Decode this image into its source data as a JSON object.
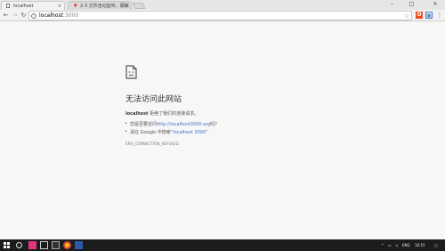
{
  "browser": {
    "tabs": [
      {
        "title": "localhost",
        "close": "×"
      },
      {
        "title": "2-3 文件自动监听，跟踪",
        "close": "×"
      }
    ],
    "window_controls": {
      "minimize": "–",
      "maximize": "□",
      "close": "×"
    },
    "nav": {
      "back": "←",
      "forward": "→",
      "reload": "↻"
    },
    "address": {
      "host": "localhost",
      "port": ":3000"
    },
    "star": "☆",
    "menu": "⋮"
  },
  "error_page": {
    "title": "无法访问此网站",
    "host": "localhost",
    "message": "拒绝了我们的连接请求。",
    "suggestions": [
      {
        "prefix": "您是否要访问",
        "link": "http://localhost3000.org",
        "suffix": "吗？"
      },
      {
        "prefix": "请在 Google 中搜索",
        "link": "“localhost 3000”",
        "suffix": ""
      }
    ],
    "error_code": "ERR_CONNECTION_REFUSED"
  },
  "taskbar": {
    "language": "ENG",
    "time": "10:15"
  },
  "colors": {
    "link": "#3b6fc4",
    "taskbar": "#1c1c1c",
    "page_bg": "#f7f7f7"
  }
}
